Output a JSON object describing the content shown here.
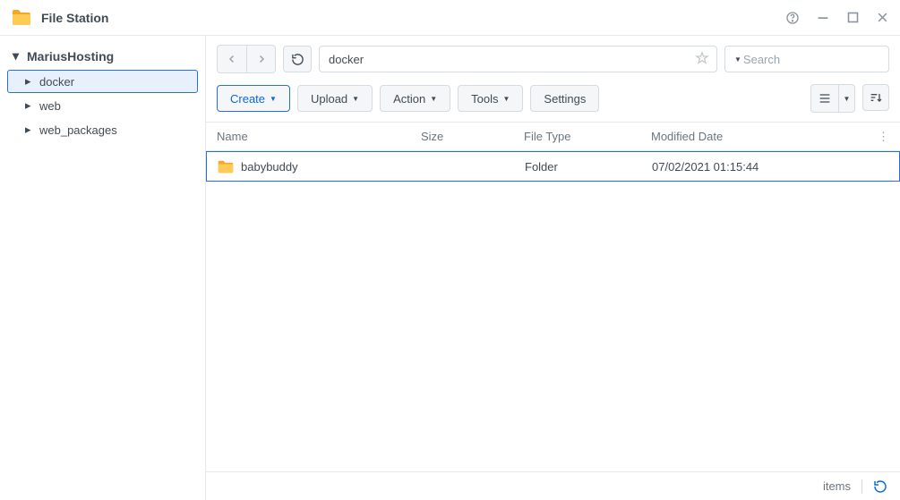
{
  "app": {
    "title": "File Station"
  },
  "sidebar": {
    "root": "MariusHosting",
    "items": [
      {
        "label": "docker",
        "selected": true
      },
      {
        "label": "web",
        "selected": false
      },
      {
        "label": "web_packages",
        "selected": false
      }
    ]
  },
  "nav": {
    "path": "docker",
    "search_placeholder": "Search"
  },
  "toolbar": {
    "create": "Create",
    "upload": "Upload",
    "action": "Action",
    "tools": "Tools",
    "settings": "Settings"
  },
  "grid": {
    "headers": {
      "name": "Name",
      "size": "Size",
      "type": "File Type",
      "modified": "Modified Date"
    },
    "rows": [
      {
        "name": "babybuddy",
        "size": "",
        "type": "Folder",
        "modified": "07/02/2021 01:15:44"
      }
    ]
  },
  "status": {
    "items_label": "items"
  }
}
